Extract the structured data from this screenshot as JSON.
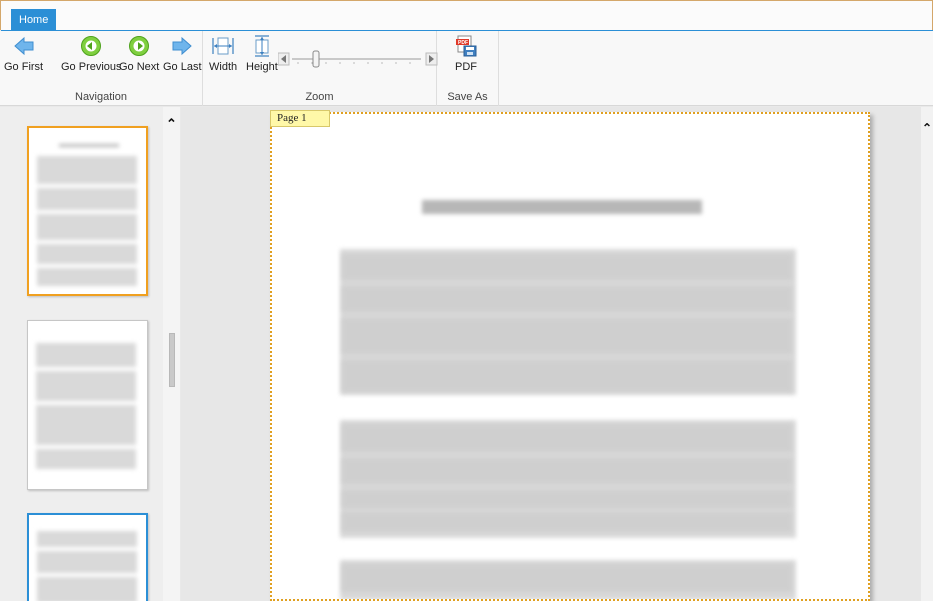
{
  "ribbon": {
    "tabs": [
      {
        "label": "Home"
      }
    ],
    "groups": {
      "navigation": {
        "caption": "Navigation",
        "buttons": {
          "first": {
            "label": "Go First",
            "icon": "arrow-left-icon"
          },
          "previous": {
            "label": "Go Previous",
            "icon": "circle-left-icon"
          },
          "next": {
            "label": "Go Next",
            "icon": "circle-right-icon"
          },
          "last": {
            "label": "Go Last",
            "icon": "arrow-right-icon"
          }
        }
      },
      "zoom": {
        "caption": "Zoom",
        "buttons": {
          "width": {
            "label": "Width",
            "icon": "fit-width-icon"
          },
          "height": {
            "label": "Height",
            "icon": "fit-height-icon"
          }
        }
      },
      "save_as": {
        "caption": "Save As",
        "buttons": {
          "pdf": {
            "label": "PDF",
            "icon": "pdf-save-icon"
          }
        }
      }
    }
  },
  "viewer": {
    "page_label": "Page 1"
  },
  "colors": {
    "accent": "#2b8fd6",
    "selection_orange": "#f0a020",
    "page_tag_bg": "#fff8a8"
  }
}
